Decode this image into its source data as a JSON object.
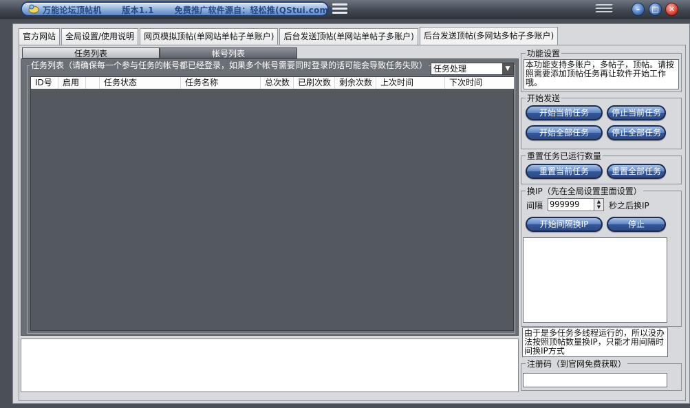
{
  "window": {
    "title": "万能论坛顶帖机",
    "version": "版本1.1",
    "promo": "免费推广软件源自：轻松推(QStui.com)"
  },
  "tabs": [
    {
      "label": "官方网站"
    },
    {
      "label": "全局设置/使用说明"
    },
    {
      "label": "网页模拟顶帖(单网站单帖子单账户)"
    },
    {
      "label": "后台发送顶帖(单网站单帖子多账户)"
    },
    {
      "label": "后台发送顶帖(多网站多帖子多账户)"
    }
  ],
  "inner_tabs": [
    {
      "label": "任务列表"
    },
    {
      "label": "帐号列表"
    }
  ],
  "task_list": {
    "group_title": "任务列表（请确保每一个参与任务的帐号都已经登录，如果多个帐号需要同时登录的话可能会导致任务失败）",
    "action_select": "任务处理",
    "columns": [
      "ID号",
      "启用",
      "",
      "任务状态",
      "任务名称",
      "总次数",
      "已刷次数",
      "剩余次数",
      "上次时间",
      "下次时间"
    ]
  },
  "right_panel": {
    "features": {
      "title": "功能设置",
      "description": "本功能支持多账户，多帖子，顶帖。请按照需要添加顶帖任务再让软件开始工作哦。"
    },
    "start": {
      "title": "开始发送",
      "start_current": "开始当前任务",
      "stop_current": "停止当前任务",
      "start_all": "开始全部任务",
      "stop_all": "停止全部任务"
    },
    "reset": {
      "title": "重置任务已运行数量",
      "reset_current": "重置当前任务",
      "reset_all": "重置全部任务"
    },
    "ip": {
      "title": "换IP（先在全局设置里面设置）",
      "interval_label": "间隔",
      "interval_value": "999999",
      "suffix_label": "秒之后换IP",
      "start_button": "开始间隔换IP",
      "stop_button": "停止",
      "note": "由于是多任务多线程运行的，所以没办法按照顶帖数量换IP，只能才用间隔时间换IP方式"
    },
    "reg": {
      "title": "注册码（到官网免费获取）"
    }
  },
  "colors": {
    "titlebar": "#3e444d",
    "dark_panel": "#6b6f76",
    "frame_bg": "#d8d9dc",
    "button_blue": "#34589a",
    "close_red": "#d93a2a"
  }
}
